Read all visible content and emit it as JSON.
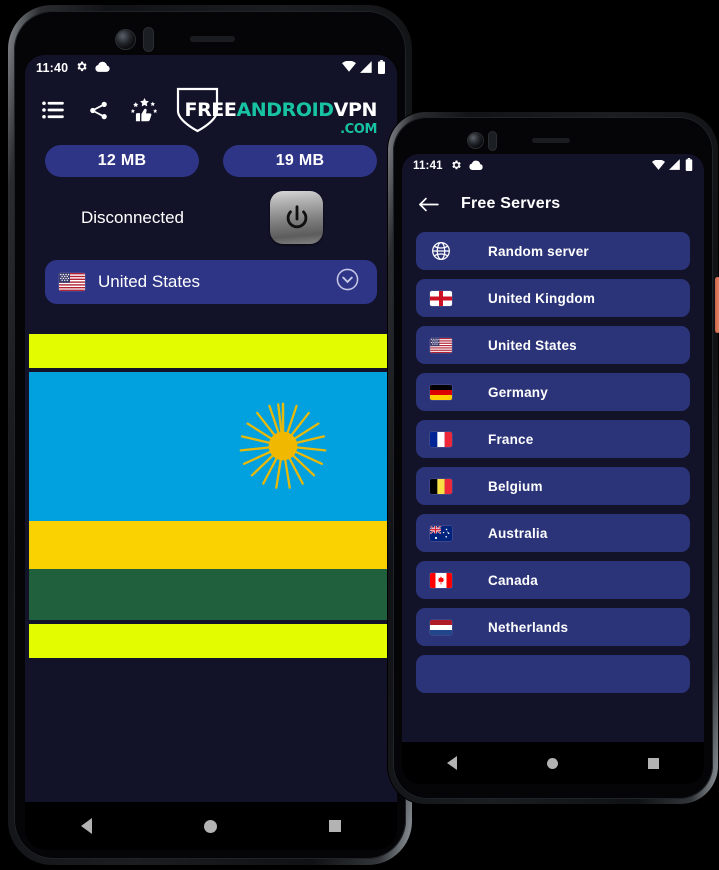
{
  "brand": {
    "logo_free": "FREE",
    "logo_android": "ANDROID",
    "logo_vpn": "VPN",
    "logo_com": ".COM",
    "accent_teal": "#17c3a2",
    "accent_blue": "#2f3586",
    "list_blue": "#2c3479",
    "app_background": "#121229"
  },
  "phone1": {
    "status_bar": {
      "time": "11:40",
      "icons_left": [
        "gear-icon",
        "cloud-icon"
      ],
      "icons_right": [
        "wifi-icon",
        "signal-icon",
        "battery-icon"
      ]
    },
    "toolbar": {
      "icons": [
        {
          "name": "list-icon",
          "label": "Servers list"
        },
        {
          "name": "share-icon",
          "label": "Share"
        },
        {
          "name": "rate-icon",
          "label": "Rate us"
        }
      ]
    },
    "stats": {
      "download": "12 MB",
      "upload": "19 MB"
    },
    "connection": {
      "status": "Disconnected",
      "power_button_label": "power-button"
    },
    "selected_server": {
      "flag": "us-flag",
      "name": "United States",
      "chevron": "chevron-down-icon"
    },
    "banner": {
      "type": "flag-banner",
      "flag": "rwanda-flag",
      "top_band_color": "#e4fc00",
      "bottom_band_color": "#e4fc00",
      "flag_colors": [
        "#00a1de",
        "#fad201",
        "#20603d"
      ]
    },
    "navbar": {
      "back": "back-nav-icon",
      "home": "home-nav-icon",
      "recents": "recents-nav-icon"
    }
  },
  "phone2": {
    "status_bar": {
      "time": "11:41",
      "icons_left": [
        "gear-icon",
        "cloud-icon"
      ],
      "icons_right": [
        "wifi-icon",
        "signal-icon",
        "battery-icon"
      ]
    },
    "appbar": {
      "back": "back-arrow-icon",
      "title": "Free Servers"
    },
    "servers": [
      {
        "flag": "globe",
        "name": "Random server"
      },
      {
        "flag": "gb",
        "name": "United Kingdom"
      },
      {
        "flag": "us",
        "name": "United States"
      },
      {
        "flag": "de",
        "name": "Germany"
      },
      {
        "flag": "fr",
        "name": "France"
      },
      {
        "flag": "be",
        "name": "Belgium"
      },
      {
        "flag": "au",
        "name": "Australia"
      },
      {
        "flag": "ca",
        "name": "Canada"
      },
      {
        "flag": "nl",
        "name": "Netherlands"
      }
    ],
    "navbar": {
      "back": "back-nav-icon",
      "home": "home-nav-icon",
      "recents": "recents-nav-icon"
    }
  }
}
